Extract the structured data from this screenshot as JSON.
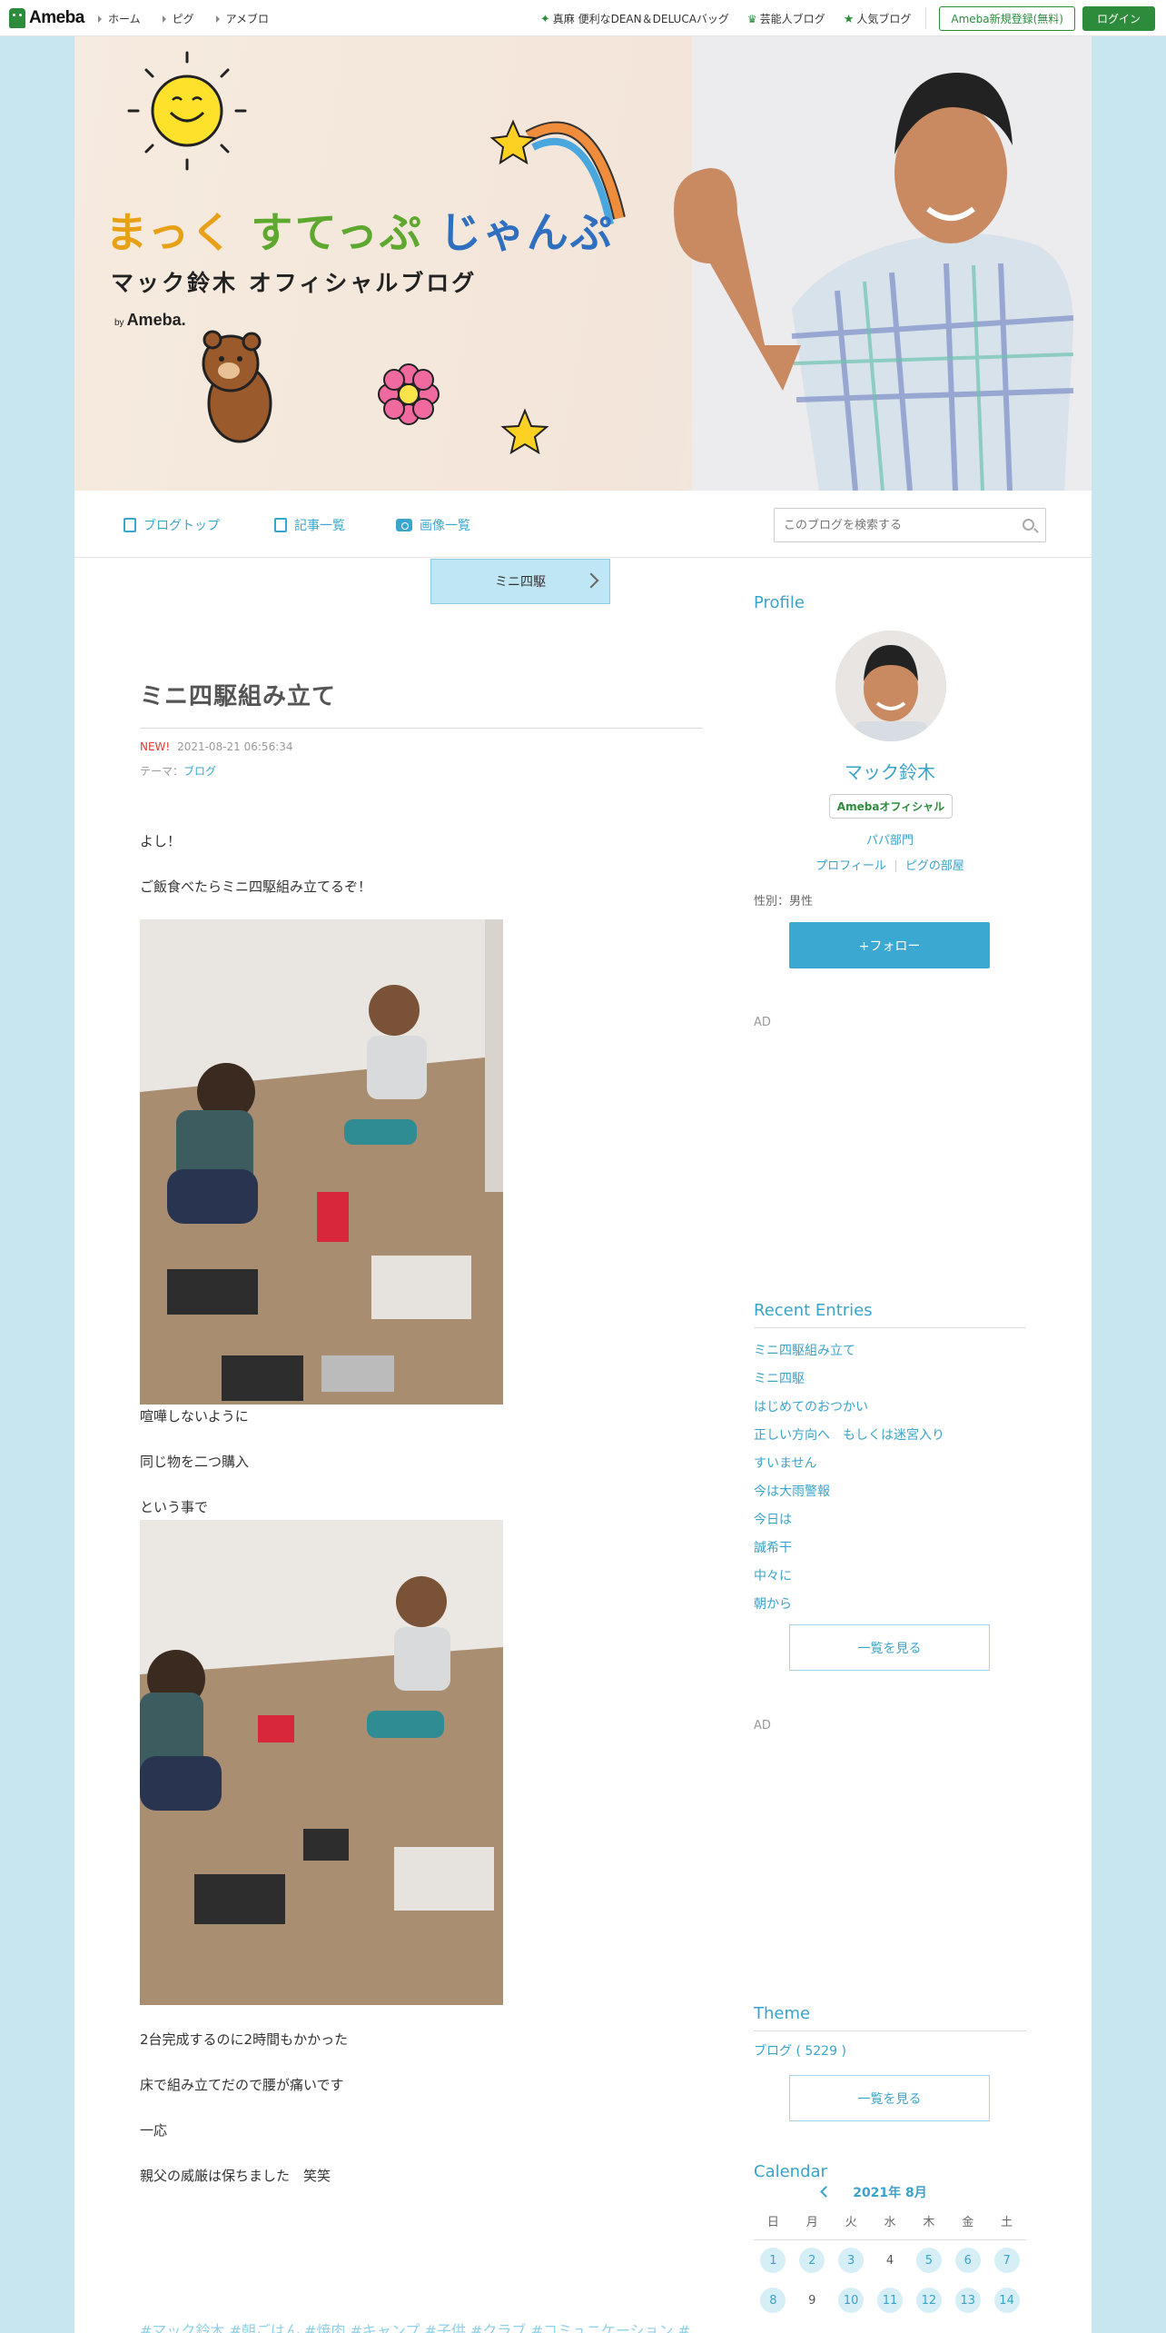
{
  "topbar": {
    "logo": "Ameba",
    "nav": [
      "ホーム",
      "ピグ",
      "アメブロ"
    ],
    "promo": "真麻 便利なDEAN＆DELUCAバッグ",
    "celeb_blog": "芸能人ブログ",
    "popular_blog": "人気ブログ",
    "register": "Ameba新規登録(無料)",
    "login": "ログイン"
  },
  "header": {
    "title_part1": "まっく",
    "title_part2": "すてっぷ",
    "title_part3": "じゃんぷ",
    "subtitle": "マック鈴木 オフィシャルブログ",
    "by": "by",
    "by_brand": "Ameba."
  },
  "blognav": {
    "items": [
      "ブログトップ",
      "記事一覧",
      "画像一覧"
    ],
    "search_placeholder": "このブログを検索する"
  },
  "entry": {
    "tag": "ミニ四駆",
    "title": "ミニ四駆組み立て",
    "new_label": "NEW!",
    "datetime": "2021-08-21 06:56:34",
    "theme_label": "テーマ：",
    "theme": "ブログ",
    "paragraphs": [
      "よし！",
      "ご飯食べたらミニ四駆組み立てるぞ！",
      "喧嘩しないように",
      "同じ物を二つ購入",
      "という事で",
      "2台完成するのに2時間もかかった",
      "床で組み立てだので腰が痛いです",
      "一応",
      "親父の威厳は保ちました　笑笑"
    ],
    "hashtags": "#マック鈴木  #朝ごはん  #焼肉  #キャンプ  #子供  #クラブ  #コミュニケーション  #"
  },
  "sidebar": {
    "profile_heading": "Profile",
    "name": "マック鈴木",
    "official_badge": "Amebaオフィシャル",
    "category": "パパ部門",
    "link_profile": "プロフィール",
    "link_room": "ピグの部屋",
    "sex": "性別：男性",
    "follow": "+フォロー",
    "ad": "AD",
    "recent_heading": "Recent Entries",
    "recent": [
      "ミニ四駆組み立て",
      "ミニ四駆",
      "はじめてのおつかい",
      "正しい方向へ　もしくは迷宮入り",
      "すいません",
      "今は大雨警報",
      "今日は",
      "誠希干",
      "中々に",
      "朝から"
    ],
    "see_all": "一覧を見る",
    "theme_heading": "Theme",
    "theme_item": "ブログ ( 5229 )",
    "calendar_heading": "Calendar",
    "calendar_month": "2021年 8月",
    "dow": [
      "日",
      "月",
      "火",
      "水",
      "木",
      "金",
      "土"
    ],
    "week1": [
      "1",
      "2",
      "3",
      "4",
      "5",
      "6",
      "7"
    ],
    "week2": [
      "8",
      "9",
      "10",
      "11",
      "12",
      "13",
      "14"
    ]
  },
  "colors": {
    "accent": "#3aa3c9",
    "ameba_green": "#2d8c3c",
    "background": "#c8e6f0",
    "new_red": "#e23a2b"
  }
}
